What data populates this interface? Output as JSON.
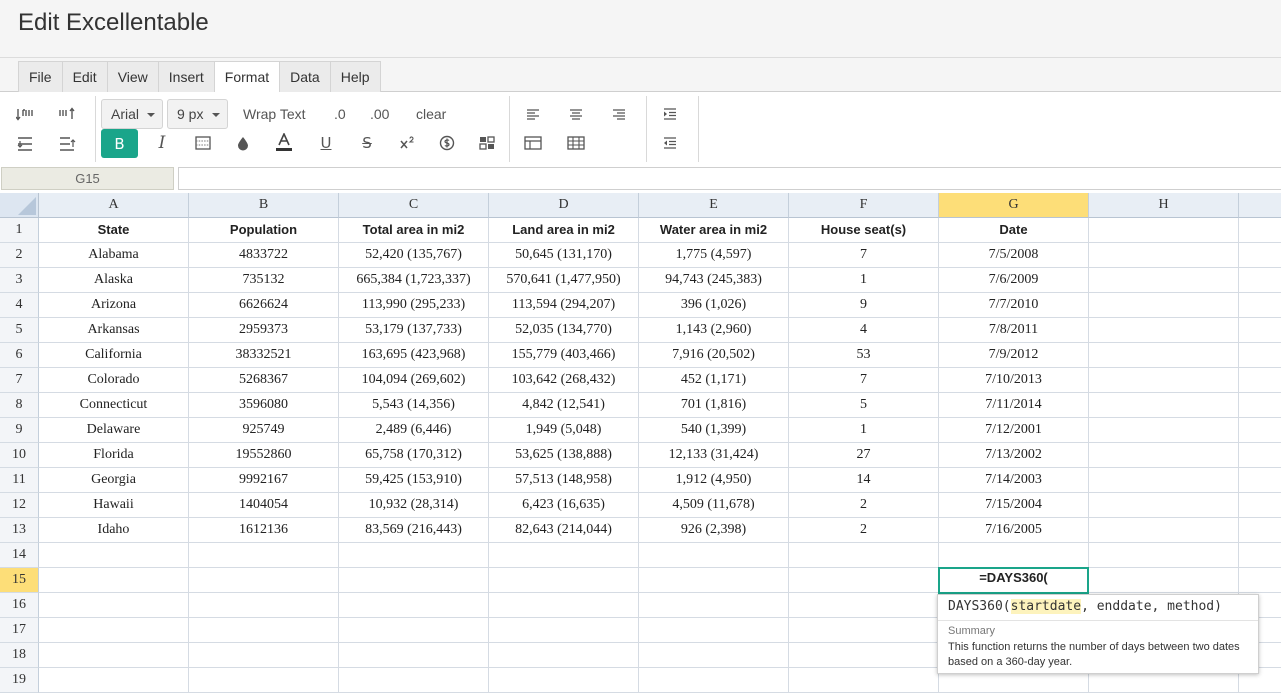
{
  "app": {
    "title": "Edit Excellentable"
  },
  "menu": {
    "tabs": [
      {
        "label": "File"
      },
      {
        "label": "Edit"
      },
      {
        "label": "View"
      },
      {
        "label": "Insert"
      },
      {
        "label": "Format"
      },
      {
        "label": "Data"
      },
      {
        "label": "Help"
      }
    ],
    "active_tab": "Format"
  },
  "toolbar": {
    "font_family": "Arial",
    "font_size": "9 px",
    "wrap_text": "Wrap Text",
    "decrease_decimal": ".0",
    "increase_decimal": ".00",
    "clear": "clear",
    "bold_label": "B",
    "italic_label": "I",
    "underline_label": "U",
    "strike_label": "S",
    "bold_active": true,
    "accent_color": "#1aa58a"
  },
  "formula_bar": {
    "cell_ref": "G15",
    "value": ""
  },
  "grid": {
    "columns": [
      "A",
      "B",
      "C",
      "D",
      "E",
      "F",
      "G",
      "H"
    ],
    "selected_column": "G",
    "selected_row": 15,
    "row_numbers": [
      "1",
      "2",
      "3",
      "4",
      "5",
      "6",
      "7",
      "8",
      "9",
      "10",
      "11",
      "12",
      "13",
      "14",
      "15",
      "16",
      "17",
      "18",
      "19"
    ],
    "rows": [
      [
        "State",
        "Population",
        "Total area in mi2",
        "Land area in mi2",
        "Water area in mi2",
        "House seat(s)",
        "Date",
        ""
      ],
      [
        "Alabama",
        "4833722",
        "52,420 (135,767)",
        "50,645 (131,170)",
        "1,775 (4,597)",
        "7",
        "7/5/2008",
        ""
      ],
      [
        "Alaska",
        "735132",
        "665,384 (1,723,337)",
        "570,641 (1,477,950)",
        "94,743 (245,383)",
        "1",
        "7/6/2009",
        ""
      ],
      [
        "Arizona",
        "6626624",
        "113,990 (295,233)",
        "113,594 (294,207)",
        "396 (1,026)",
        "9",
        "7/7/2010",
        ""
      ],
      [
        "Arkansas",
        "2959373",
        "53,179 (137,733)",
        "52,035 (134,770)",
        "1,143 (2,960)",
        "4",
        "7/8/2011",
        ""
      ],
      [
        "California",
        "38332521",
        "163,695 (423,968)",
        "155,779 (403,466)",
        "7,916 (20,502)",
        "53",
        "7/9/2012",
        ""
      ],
      [
        "Colorado",
        "5268367",
        "104,094 (269,602)",
        "103,642 (268,432)",
        "452 (1,171)",
        "7",
        "7/10/2013",
        ""
      ],
      [
        "Connecticut",
        "3596080",
        "5,543 (14,356)",
        "4,842 (12,541)",
        "701 (1,816)",
        "5",
        "7/11/2014",
        ""
      ],
      [
        "Delaware",
        "925749",
        "2,489 (6,446)",
        "1,949 (5,048)",
        "540 (1,399)",
        "1",
        "7/12/2001",
        ""
      ],
      [
        "Florida",
        "19552860",
        "65,758 (170,312)",
        "53,625 (138,888)",
        "12,133 (31,424)",
        "27",
        "7/13/2002",
        ""
      ],
      [
        "Georgia",
        "9992167",
        "59,425 (153,910)",
        "57,513 (148,958)",
        "1,912 (4,950)",
        "14",
        "7/14/2003",
        ""
      ],
      [
        "Hawaii",
        "1404054",
        "10,932 (28,314)",
        "6,423 (16,635)",
        "4,509 (11,678)",
        "2",
        "7/15/2004",
        ""
      ],
      [
        "Idaho",
        "1612136",
        "83,569 (216,443)",
        "82,643 (214,044)",
        "926 (2,398)",
        "2",
        "7/16/2005",
        ""
      ],
      [
        "",
        "",
        "",
        "",
        "",
        "",
        "",
        ""
      ],
      [
        "",
        "",
        "",
        "",
        "",
        "",
        "=DAYS360(",
        ""
      ],
      [
        "",
        "",
        "",
        "",
        "",
        "",
        "",
        ""
      ],
      [
        "",
        "",
        "",
        "",
        "",
        "",
        "",
        ""
      ],
      [
        "",
        "",
        "",
        "",
        "",
        "",
        "",
        ""
      ],
      [
        "",
        "",
        "",
        "",
        "",
        "",
        "",
        ""
      ]
    ]
  },
  "editing_cell": {
    "ref": "G15",
    "value": "=DAYS360("
  },
  "function_tooltip": {
    "name": "DAYS360(",
    "highlighted_param": "startdate",
    "rest": ", enddate, method)",
    "summary_label": "Summary",
    "summary_text": "This function returns the number of days between two dates based on a 360-day year."
  }
}
